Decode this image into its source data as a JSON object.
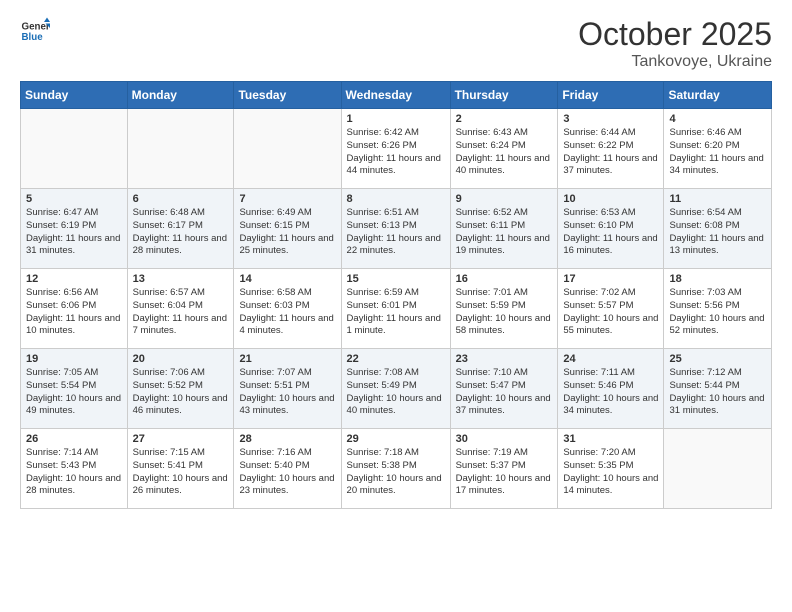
{
  "header": {
    "logo_general": "General",
    "logo_blue": "Blue",
    "month": "October 2025",
    "location": "Tankovoye, Ukraine"
  },
  "weekdays": [
    "Sunday",
    "Monday",
    "Tuesday",
    "Wednesday",
    "Thursday",
    "Friday",
    "Saturday"
  ],
  "weeks": [
    [
      {
        "day": "",
        "info": ""
      },
      {
        "day": "",
        "info": ""
      },
      {
        "day": "",
        "info": ""
      },
      {
        "day": "1",
        "info": "Sunrise: 6:42 AM\nSunset: 6:26 PM\nDaylight: 11 hours\nand 44 minutes."
      },
      {
        "day": "2",
        "info": "Sunrise: 6:43 AM\nSunset: 6:24 PM\nDaylight: 11 hours\nand 40 minutes."
      },
      {
        "day": "3",
        "info": "Sunrise: 6:44 AM\nSunset: 6:22 PM\nDaylight: 11 hours\nand 37 minutes."
      },
      {
        "day": "4",
        "info": "Sunrise: 6:46 AM\nSunset: 6:20 PM\nDaylight: 11 hours\nand 34 minutes."
      }
    ],
    [
      {
        "day": "5",
        "info": "Sunrise: 6:47 AM\nSunset: 6:19 PM\nDaylight: 11 hours\nand 31 minutes."
      },
      {
        "day": "6",
        "info": "Sunrise: 6:48 AM\nSunset: 6:17 PM\nDaylight: 11 hours\nand 28 minutes."
      },
      {
        "day": "7",
        "info": "Sunrise: 6:49 AM\nSunset: 6:15 PM\nDaylight: 11 hours\nand 25 minutes."
      },
      {
        "day": "8",
        "info": "Sunrise: 6:51 AM\nSunset: 6:13 PM\nDaylight: 11 hours\nand 22 minutes."
      },
      {
        "day": "9",
        "info": "Sunrise: 6:52 AM\nSunset: 6:11 PM\nDaylight: 11 hours\nand 19 minutes."
      },
      {
        "day": "10",
        "info": "Sunrise: 6:53 AM\nSunset: 6:10 PM\nDaylight: 11 hours\nand 16 minutes."
      },
      {
        "day": "11",
        "info": "Sunrise: 6:54 AM\nSunset: 6:08 PM\nDaylight: 11 hours\nand 13 minutes."
      }
    ],
    [
      {
        "day": "12",
        "info": "Sunrise: 6:56 AM\nSunset: 6:06 PM\nDaylight: 11 hours\nand 10 minutes."
      },
      {
        "day": "13",
        "info": "Sunrise: 6:57 AM\nSunset: 6:04 PM\nDaylight: 11 hours\nand 7 minutes."
      },
      {
        "day": "14",
        "info": "Sunrise: 6:58 AM\nSunset: 6:03 PM\nDaylight: 11 hours\nand 4 minutes."
      },
      {
        "day": "15",
        "info": "Sunrise: 6:59 AM\nSunset: 6:01 PM\nDaylight: 11 hours\nand 1 minute."
      },
      {
        "day": "16",
        "info": "Sunrise: 7:01 AM\nSunset: 5:59 PM\nDaylight: 10 hours\nand 58 minutes."
      },
      {
        "day": "17",
        "info": "Sunrise: 7:02 AM\nSunset: 5:57 PM\nDaylight: 10 hours\nand 55 minutes."
      },
      {
        "day": "18",
        "info": "Sunrise: 7:03 AM\nSunset: 5:56 PM\nDaylight: 10 hours\nand 52 minutes."
      }
    ],
    [
      {
        "day": "19",
        "info": "Sunrise: 7:05 AM\nSunset: 5:54 PM\nDaylight: 10 hours\nand 49 minutes."
      },
      {
        "day": "20",
        "info": "Sunrise: 7:06 AM\nSunset: 5:52 PM\nDaylight: 10 hours\nand 46 minutes."
      },
      {
        "day": "21",
        "info": "Sunrise: 7:07 AM\nSunset: 5:51 PM\nDaylight: 10 hours\nand 43 minutes."
      },
      {
        "day": "22",
        "info": "Sunrise: 7:08 AM\nSunset: 5:49 PM\nDaylight: 10 hours\nand 40 minutes."
      },
      {
        "day": "23",
        "info": "Sunrise: 7:10 AM\nSunset: 5:47 PM\nDaylight: 10 hours\nand 37 minutes."
      },
      {
        "day": "24",
        "info": "Sunrise: 7:11 AM\nSunset: 5:46 PM\nDaylight: 10 hours\nand 34 minutes."
      },
      {
        "day": "25",
        "info": "Sunrise: 7:12 AM\nSunset: 5:44 PM\nDaylight: 10 hours\nand 31 minutes."
      }
    ],
    [
      {
        "day": "26",
        "info": "Sunrise: 7:14 AM\nSunset: 5:43 PM\nDaylight: 10 hours\nand 28 minutes."
      },
      {
        "day": "27",
        "info": "Sunrise: 7:15 AM\nSunset: 5:41 PM\nDaylight: 10 hours\nand 26 minutes."
      },
      {
        "day": "28",
        "info": "Sunrise: 7:16 AM\nSunset: 5:40 PM\nDaylight: 10 hours\nand 23 minutes."
      },
      {
        "day": "29",
        "info": "Sunrise: 7:18 AM\nSunset: 5:38 PM\nDaylight: 10 hours\nand 20 minutes."
      },
      {
        "day": "30",
        "info": "Sunrise: 7:19 AM\nSunset: 5:37 PM\nDaylight: 10 hours\nand 17 minutes."
      },
      {
        "day": "31",
        "info": "Sunrise: 7:20 AM\nSunset: 5:35 PM\nDaylight: 10 hours\nand 14 minutes."
      },
      {
        "day": "",
        "info": ""
      }
    ]
  ]
}
